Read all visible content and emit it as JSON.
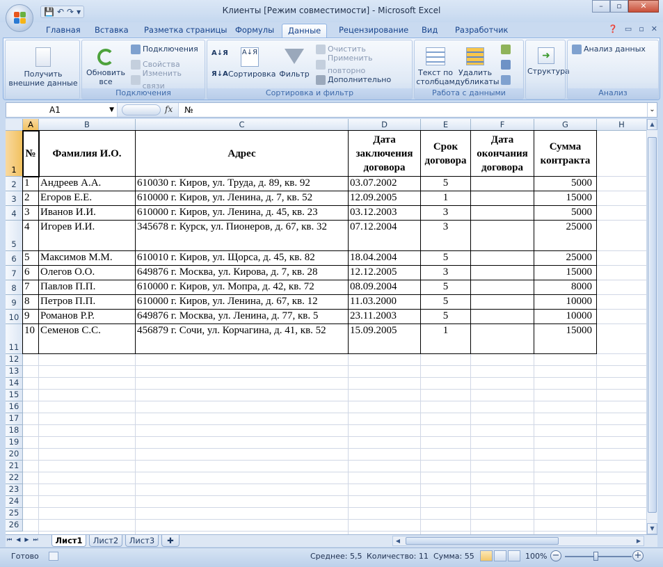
{
  "window": {
    "title": "Клиенты  [Режим совместимости] - Microsoft Excel",
    "min": "–",
    "max": "▫",
    "close": "✕"
  },
  "qat": {
    "save": "💾",
    "undo": "↶",
    "redo": "↷",
    "more": "▾"
  },
  "tabs": [
    "Главная",
    "Вставка",
    "Разметка страницы",
    "Формулы",
    "Данные",
    "Рецензирование",
    "Вид",
    "Разработчик"
  ],
  "active_tab": "Данные",
  "ribbon": {
    "get_external": "Получить внешние данные",
    "refresh_all": "Обновить все",
    "connections": "Подключения",
    "properties": "Свойства",
    "edit_links": "Изменить связи",
    "group_connections": "Подключения",
    "sort_az": "А↓Я",
    "sort": "Сортировка",
    "filter": "Фильтр",
    "clear": "Очистить",
    "reapply": "Применить повторно",
    "advanced": "Дополнительно",
    "group_sort_filter": "Сортировка и фильтр",
    "text_to_columns": "Текст по столбцам",
    "remove_duplicates": "Удалить дубликаты",
    "group_data_tools": "Работа с данными",
    "outline": "Структура",
    "data_analysis": "Анализ данных",
    "group_analysis": "Анализ"
  },
  "formula_bar": {
    "name_box": "A1",
    "fx": "fx",
    "content": "№"
  },
  "columns": [
    "A",
    "B",
    "C",
    "D",
    "E",
    "F",
    "G",
    "H"
  ],
  "row_numbers": [
    "1",
    "2",
    "3",
    "4",
    "5",
    "6",
    "7",
    "8",
    "9",
    "10",
    "11",
    "12",
    "13",
    "14",
    "15",
    "16",
    "17",
    "18",
    "19",
    "20",
    "21",
    "22",
    "23",
    "24",
    "25",
    "26"
  ],
  "table": {
    "headers": [
      "№",
      "Фамилия И.О.",
      "Адрес",
      "Дата заключения договора",
      "Срок договора",
      "Дата окончания договора",
      "Сумма контракта"
    ],
    "rows": [
      [
        "1",
        "Андреев А.А.",
        "610030 г. Киров, ул. Труда, д. 89, кв. 92",
        "03.07.2002",
        "5",
        "",
        "5000"
      ],
      [
        "2",
        "Егоров Е.Е.",
        "610000 г. Киров, ул. Ленина, д. 7, кв. 52",
        "12.09.2005",
        "1",
        "",
        "15000"
      ],
      [
        "3",
        "Иванов И.И.",
        "610000 г. Киров, ул. Ленина, д. 45, кв. 23",
        "03.12.2003",
        "3",
        "",
        "5000"
      ],
      [
        "4",
        "Игорев И.И.",
        "345678 г. Курск, ул. Пионеров, д. 67, кв. 32",
        "07.12.2004",
        "3",
        "",
        "25000"
      ],
      [
        "5",
        "Максимов М.М.",
        "610010 г. Киров, ул. Щорса, д. 45, кв. 82",
        "18.04.2004",
        "5",
        "",
        "25000"
      ],
      [
        "6",
        "Олегов О.О.",
        "649876 г. Москва, ул. Кирова, д. 7, кв. 28",
        "12.12.2005",
        "3",
        "",
        "15000"
      ],
      [
        "7",
        "Павлов П.П.",
        "610000 г. Киров, ул. Мопра, д. 42, кв. 72",
        "08.09.2004",
        "5",
        "",
        "8000"
      ],
      [
        "8",
        "Петров П.П.",
        "610000 г. Киров, ул. Ленина, д. 67, кв. 12",
        "11.03.2000",
        "5",
        "",
        "10000"
      ],
      [
        "9",
        "Романов Р.Р.",
        "649876 г. Москва, ул. Ленина, д. 77, кв. 5",
        "23.11.2003",
        "5",
        "",
        "10000"
      ],
      [
        "10",
        "Семенов С.С.",
        "456879 г. Сочи, ул. Корчагина, д. 41, кв. 52",
        "15.09.2005",
        "1",
        "",
        "15000"
      ]
    ]
  },
  "sheets": [
    "Лист1",
    "Лист2",
    "Лист3"
  ],
  "active_sheet": "Лист1",
  "status": {
    "ready": "Готово",
    "average": "Среднее: 5,5",
    "count": "Количество: 11",
    "sum": "Сумма: 55",
    "zoom": "100%",
    "zoom_minus": "−",
    "zoom_plus": "+"
  },
  "colors": {
    "accent": "#15428b",
    "selected_header": "#f1c15f",
    "gridline": "#d0d7e5"
  }
}
